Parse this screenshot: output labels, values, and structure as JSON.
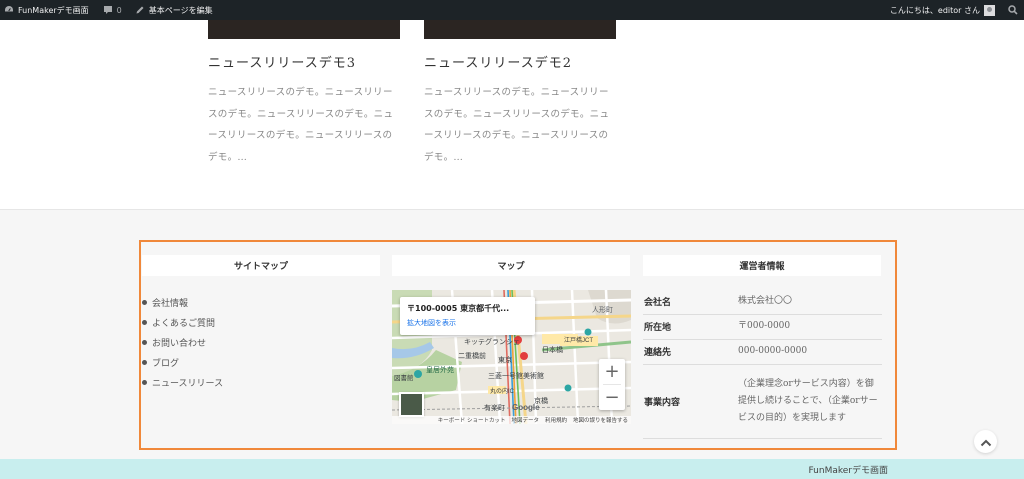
{
  "adminbar": {
    "site_name": "FunMakerデモ画面",
    "comments_count": "0",
    "edit_label": "基本ページを編集",
    "greeting": "こんにちは、editor さん"
  },
  "news": [
    {
      "title": "ニュースリリースデモ3",
      "excerpt": "ニュースリリースのデモ。ニュースリリースのデモ。ニュースリリースのデモ。ニュースリリースのデモ。ニュースリリースのデモ。…"
    },
    {
      "title": "ニュースリリースデモ2",
      "excerpt": "ニュースリリースのデモ。ニュースリリースのデモ。ニュースリリースのデモ。ニュースリリースのデモ。ニュースリリースのデモ。…"
    }
  ],
  "footer": {
    "sitemap": {
      "heading": "サイトマップ",
      "items": [
        "会社情報",
        "よくあるご質問",
        "お問い合わせ",
        "ブログ",
        "ニュースリリース"
      ]
    },
    "map": {
      "heading": "マップ",
      "address": "〒100-0005 東京都千代...",
      "enlarge_link": "拡大地図を表示",
      "zoom_in": "+",
      "zoom_out": "−",
      "labels": {
        "jinkocho": "人形町",
        "edobashi": "江戸橋JCT",
        "nihonbashi": "日本橋",
        "kokyo_gaien": "皇居外苑",
        "mitsubishi": "三菱一号館美術館",
        "marunouchi": "丸の内IC",
        "kyobashi": "京橋",
        "tokyo": "東京",
        "nijubashi": "二重橋前",
        "kitte": "キッテグランシェ",
        "library": "図書館",
        "yurakucho": "有楽町"
      },
      "attribution": [
        "キーボード ショートカット",
        "地図データ",
        "利用規約",
        "地図の誤りを報告する"
      ],
      "google": "Google"
    },
    "operator": {
      "heading": "運営者情報",
      "rows": [
        {
          "key": "会社名",
          "value": "株式会社〇〇"
        },
        {
          "key": "所在地",
          "value": "〒000-0000"
        },
        {
          "key": "連絡先",
          "value": "000-0000-0000"
        },
        {
          "key": "事業内容",
          "value": "（企業理念orサービス内容）を御提供し続けることで、（企業orサービスの目的）を実現します"
        }
      ]
    }
  },
  "copyright": "FunMakerデモ画面",
  "colors": {
    "accent_border": "#f0883a",
    "adminbar_bg": "#1d2327",
    "copyright_bg": "#c8eeee"
  }
}
